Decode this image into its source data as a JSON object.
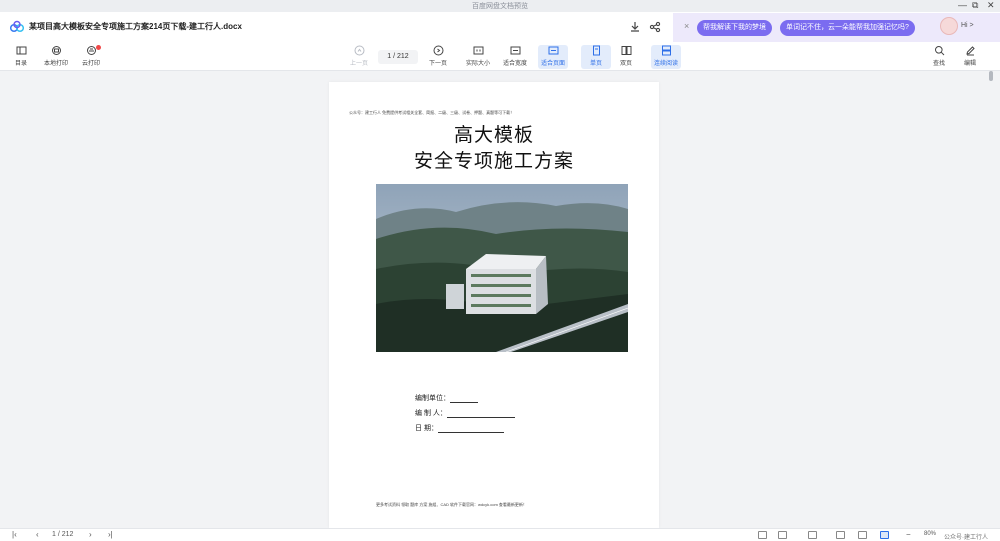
{
  "window": {
    "app_title": "百度网盘文档预览"
  },
  "header": {
    "doc_title": "某项目高大模板安全专项施工方案214页下载-建工行人.docx",
    "download_icon": "download-icon",
    "share_icon": "share-icon"
  },
  "assistant": {
    "chip1": "帮我解读下我的梦境",
    "chip2": "单词记不住，云一朵能帮我加强记忆吗?",
    "greeting": "Hi >"
  },
  "toolbar": {
    "outline": "目录",
    "local_print": "本地打印",
    "cloud_print": "云打印",
    "prev": "上一页",
    "page_indicator": "1 / 212",
    "next": "下一页",
    "actual_size": "实际大小",
    "fit_width": "适合宽度",
    "fit_page": "适合页面",
    "single": "单页",
    "double": "双页",
    "continuous": "连续阅读",
    "find": "查找",
    "edit": "编辑"
  },
  "document": {
    "top_note": "公众号：建工行人 免费提供考试相关全套、简报、二级、三级、试卷、押题、真题等可下载！",
    "title_line1": "高大模板",
    "title_line2": "安全专项施工方案",
    "form": {
      "unit_label": "编制单位：",
      "author_label": "编  制  人：",
      "date_label": "日      期："
    },
    "footer_note": "更多考试资料 领取 题库 方案 施组、CAD 软件下载官网：wdcyk.com 查看最新更新！"
  },
  "statusbar": {
    "page_indicator": "1 / 212",
    "zoom": "80%",
    "watermark": "公众号·建工行人"
  }
}
